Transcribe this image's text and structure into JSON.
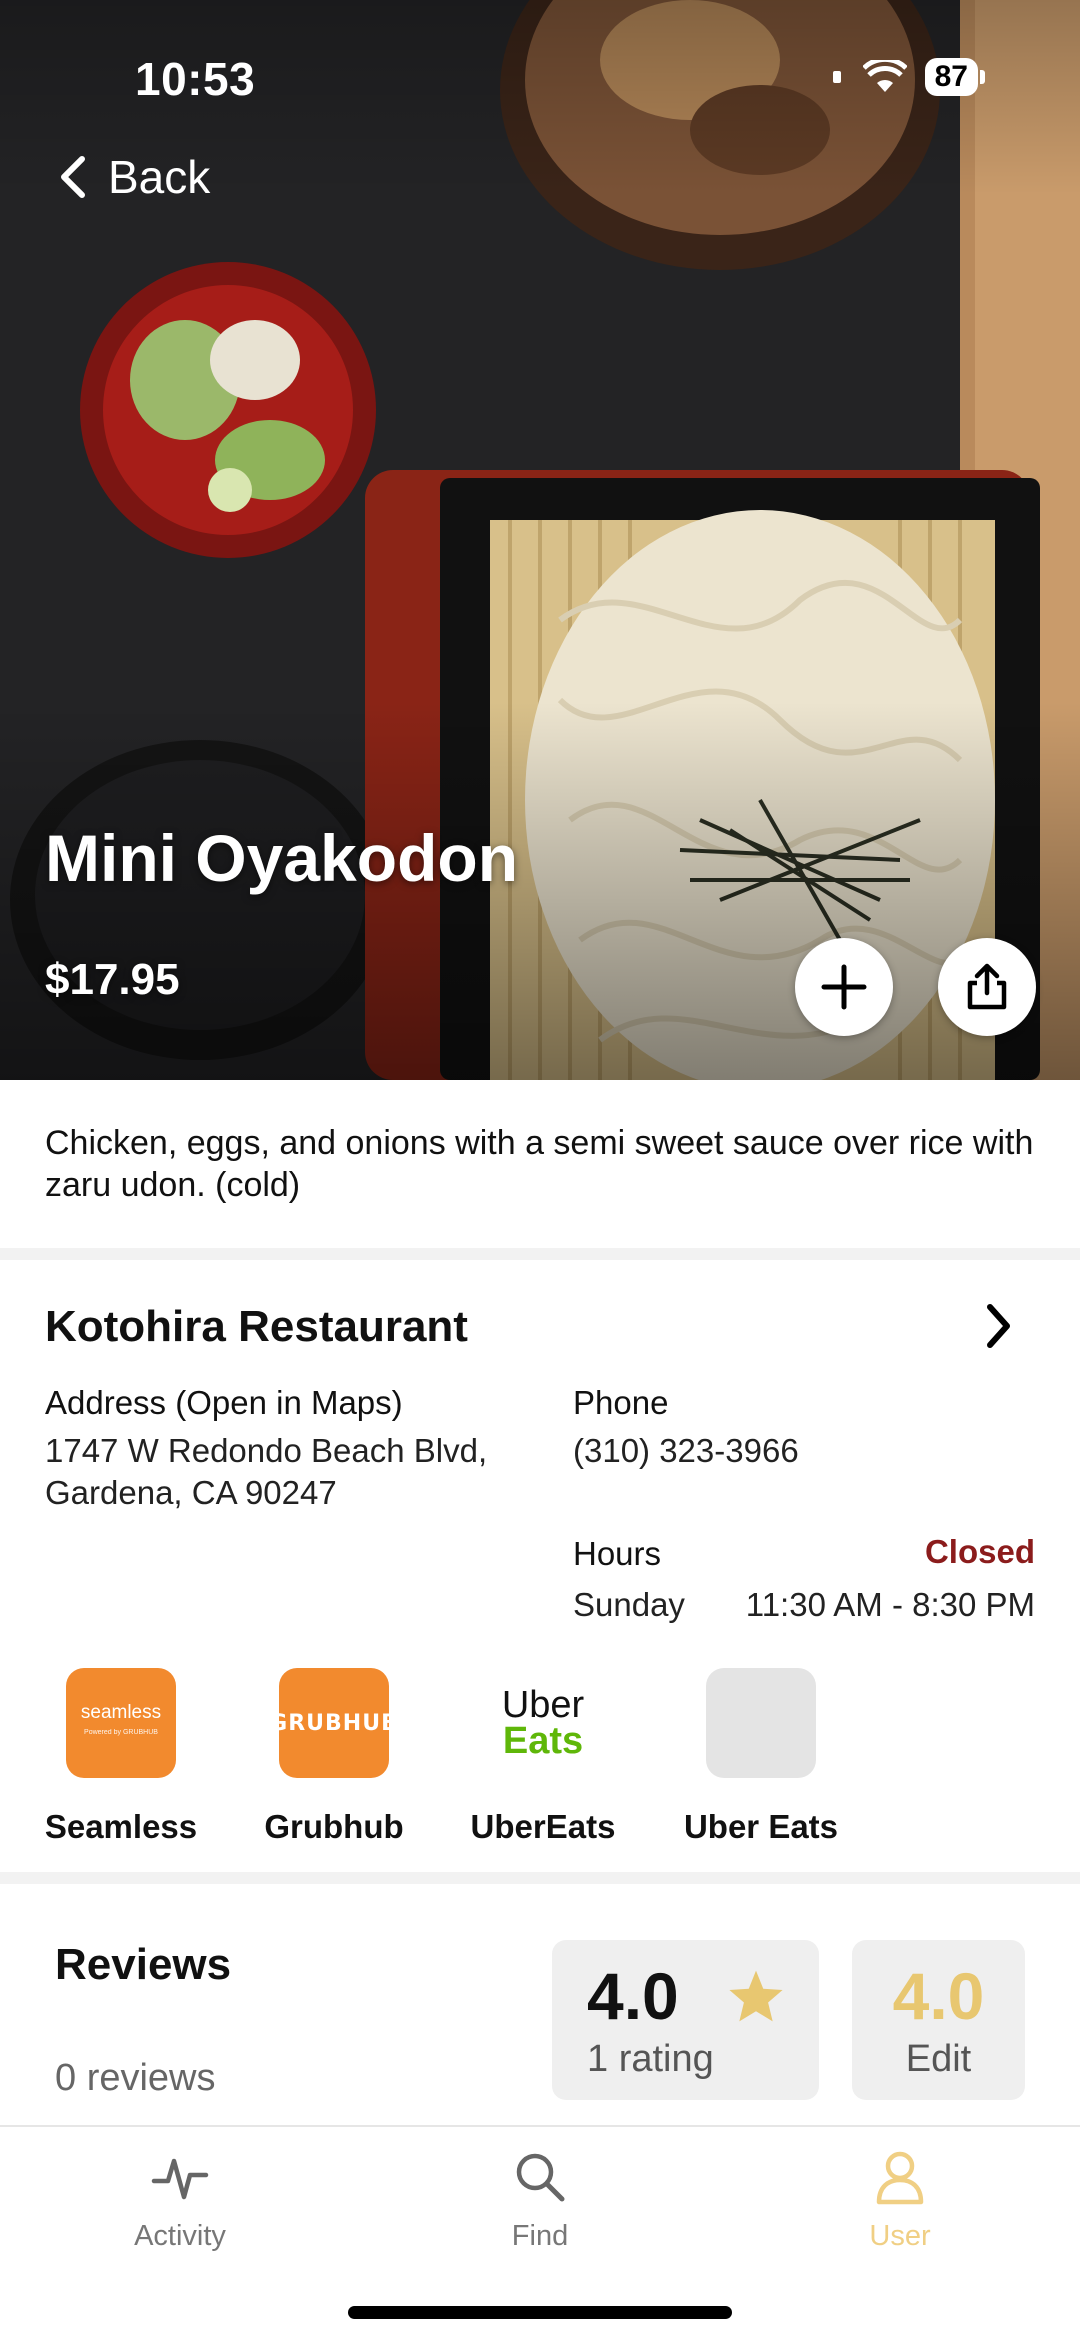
{
  "status_bar": {
    "time": "10:53",
    "battery": "87"
  },
  "nav": {
    "back_label": "Back"
  },
  "dish": {
    "title": "Mini Oyakodon",
    "price": "$17.95",
    "description": "Chicken, eggs, and onions with a semi sweet sauce over rice with zaru udon. (cold)"
  },
  "restaurant": {
    "name": "Kotohira Restaurant",
    "address_label": "Address (Open in Maps)",
    "address_line1": "1747 W Redondo Beach Blvd,",
    "address_line2": "Gardena, CA 90247",
    "phone_label": "Phone",
    "phone": "(310) 323-3966",
    "hours_label": "Hours",
    "status": "Closed",
    "hours_day": "Sunday",
    "hours_time": "11:30 AM - 8:30 PM"
  },
  "delivery": [
    {
      "name": "Seamless",
      "logo_text": "seamless",
      "logo_sub": "Powered by GRUBHUB",
      "color": "#f28a2e"
    },
    {
      "name": "Grubhub",
      "logo_text": "GRUBHUB",
      "color": "#f28a2e"
    },
    {
      "name": "UberEats",
      "logo_line1": "Uber",
      "logo_line2": "Eats",
      "color": "#5fb709"
    },
    {
      "name": "Uber Eats",
      "color": "#e4e4e4"
    }
  ],
  "reviews": {
    "title": "Reviews",
    "count_text": "0 reviews",
    "average": "4.0",
    "rating_count": "1 rating",
    "my_rating": "4.0",
    "edit_label": "Edit"
  },
  "tabs": [
    {
      "label": "Activity",
      "icon": "activity-icon"
    },
    {
      "label": "Find",
      "icon": "search-icon"
    },
    {
      "label": "User",
      "icon": "user-icon",
      "active": true
    }
  ],
  "colors": {
    "accent": "#f0cf84",
    "closed": "#8b1c1c",
    "star": "#e8c770"
  }
}
